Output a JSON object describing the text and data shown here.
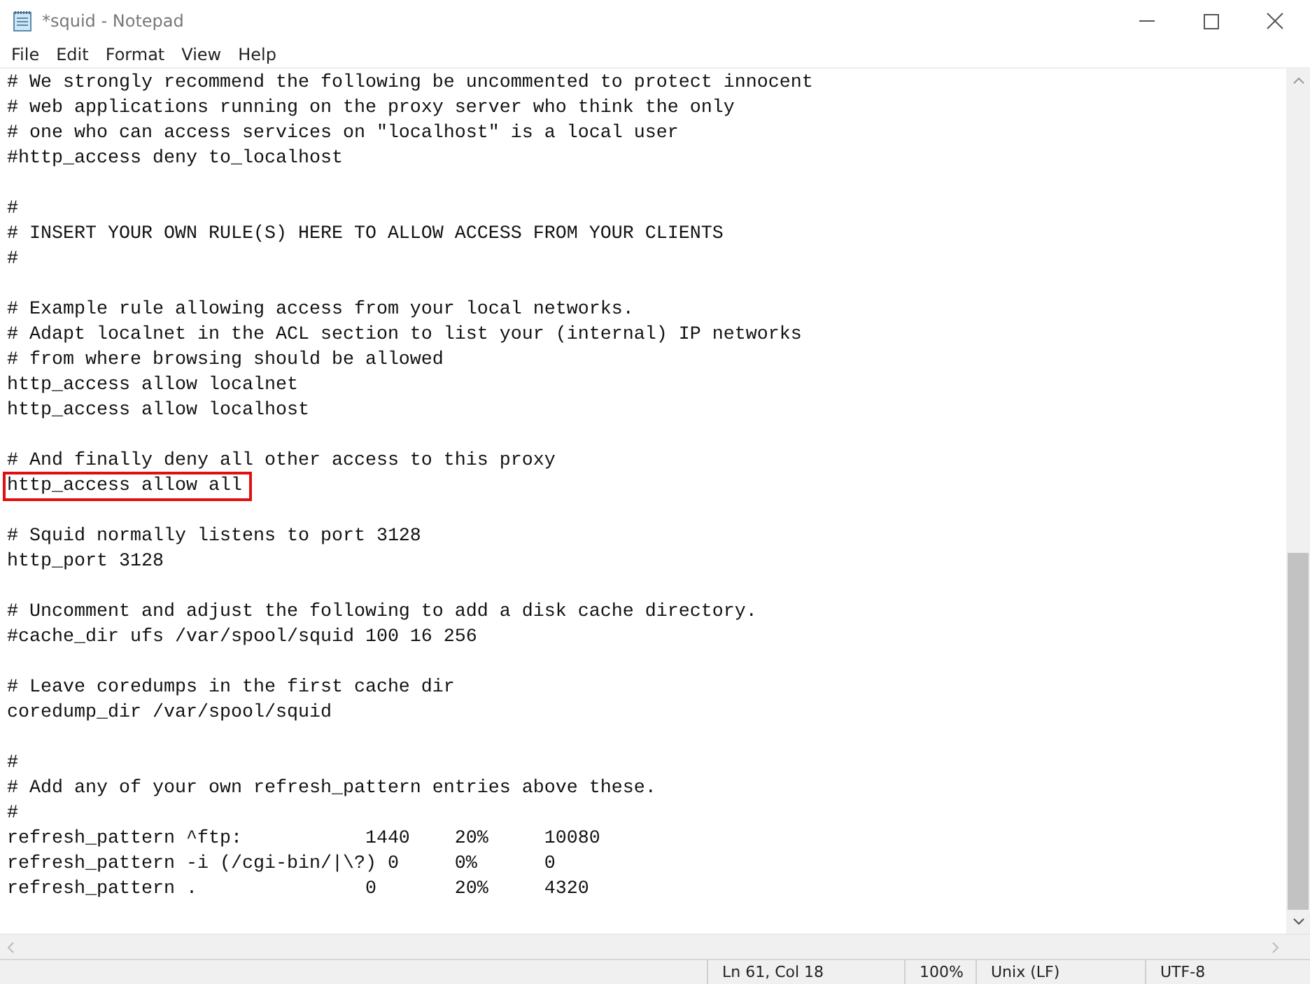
{
  "window": {
    "title": "*squid - Notepad"
  },
  "menu": [
    "File",
    "Edit",
    "Format",
    "View",
    "Help"
  ],
  "blocks": [
    [
      {
        "text": "# We strongly recommend the following be uncommented to protect innocent",
        "highlighted": false
      },
      {
        "text": "# web applications running on the proxy server who think the only",
        "highlighted": false
      },
      {
        "text": "# one who can access services on \"localhost\" is a local user",
        "highlighted": false
      },
      {
        "text": "#http_access deny to_localhost",
        "highlighted": false
      }
    ],
    [
      {
        "text": "#",
        "highlighted": false
      },
      {
        "text": "# INSERT YOUR OWN RULE(S) HERE TO ALLOW ACCESS FROM YOUR CLIENTS",
        "highlighted": false
      },
      {
        "text": "#",
        "highlighted": false
      }
    ],
    [
      {
        "text": "# Example rule allowing access from your local networks.",
        "highlighted": false
      },
      {
        "text": "# Adapt localnet in the ACL section to list your (internal) IP networks",
        "highlighted": false
      },
      {
        "text": "# from where browsing should be allowed",
        "highlighted": false
      },
      {
        "text": "http_access allow localnet",
        "highlighted": false
      },
      {
        "text": "http_access allow localhost",
        "highlighted": false
      }
    ],
    [
      {
        "text": "# And finally deny all other access to this proxy",
        "highlighted": false
      },
      {
        "text": "http_access allow all",
        "highlighted": true
      }
    ],
    [
      {
        "text": "# Squid normally listens to port 3128",
        "highlighted": false
      },
      {
        "text": "http_port 3128",
        "highlighted": false
      }
    ],
    [
      {
        "text": "# Uncomment and adjust the following to add a disk cache directory.",
        "highlighted": false
      },
      {
        "text": "#cache_dir ufs /var/spool/squid 100 16 256",
        "highlighted": false
      }
    ],
    [
      {
        "text": "# Leave coredumps in the first cache dir",
        "highlighted": false
      },
      {
        "text": "coredump_dir /var/spool/squid",
        "highlighted": false
      }
    ],
    [
      {
        "text": "#",
        "highlighted": false
      },
      {
        "text": "# Add any of your own refresh_pattern entries above these.",
        "highlighted": false
      },
      {
        "text": "#",
        "highlighted": false
      },
      {
        "text": "refresh_pattern ^ftp:           1440    20%     10080",
        "highlighted": false
      },
      {
        "text": "refresh_pattern -i (/cgi-bin/|\\?) 0     0%      0",
        "highlighted": false
      },
      {
        "text": "refresh_pattern .               0       20%     4320",
        "highlighted": false
      }
    ]
  ],
  "status_bar": [
    "Ln 61, Col 18",
    "100%",
    "Unix (LF)",
    "UTF-8"
  ]
}
